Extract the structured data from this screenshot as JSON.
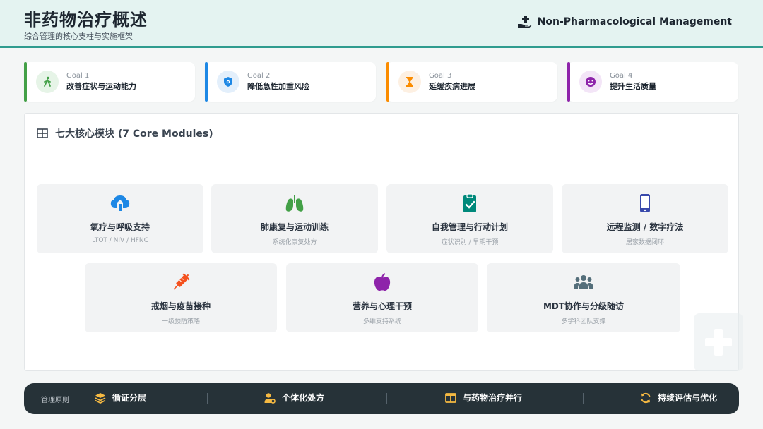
{
  "header": {
    "title": "非药物治疗概述",
    "subtitle": "综合管理的核心支柱与实施框架",
    "brand_label": "Non-Pharmacological Management",
    "brand_icon": "hand-holding-medical-icon"
  },
  "goals": [
    {
      "number": "Goal 1",
      "label": "改善症状与运动能力",
      "color": "#43a047",
      "icon": "walking-person-icon"
    },
    {
      "number": "Goal 2",
      "label": "降低急性加重风险",
      "color": "#1e88e5",
      "icon": "shield-virus-icon"
    },
    {
      "number": "Goal 3",
      "label": "延缓疾病进展",
      "color": "#fb8c00",
      "icon": "hourglass-icon"
    },
    {
      "number": "Goal 4",
      "label": "提升生活质量",
      "color": "#8e24aa",
      "icon": "smile-icon"
    }
  ],
  "modules_panel": {
    "title": "七大核心模块 (7 Core Modules)",
    "title_icon": "grid-icon",
    "modules": [
      {
        "title": "氧疗与呼吸支持",
        "subtitle": "LTOT / NIV / HFNC",
        "icon": "lungs-virus-icon",
        "color": "#1e88e5"
      },
      {
        "title": "肺康复与运动训练",
        "subtitle": "系统化康复处方",
        "icon": "lungs-icon",
        "color": "#43a047"
      },
      {
        "title": "自我管理与行动计划",
        "subtitle": "症状识别 / 早期干预",
        "icon": "clipboard-check-icon",
        "color": "#00897b"
      },
      {
        "title": "远程监测 / 数字疗法",
        "subtitle": "居家数据闭环",
        "icon": "mobile-phone-icon",
        "color": "#3949ab"
      },
      {
        "title": "戒烟与疫苗接种",
        "subtitle": "一级预防策略",
        "icon": "syringe-icon",
        "color": "#f4511e"
      },
      {
        "title": "营养与心理干预",
        "subtitle": "多维支持系统",
        "icon": "apple-icon",
        "color": "#8e24aa"
      },
      {
        "title": "MDT协作与分级随访",
        "subtitle": "多学科团队支撑",
        "icon": "users-icon",
        "color": "#546e7a"
      }
    ]
  },
  "footer": {
    "label": "管理原则",
    "items": [
      {
        "label": "循证分层",
        "icon": "layers-icon"
      },
      {
        "label": "个体化处方",
        "icon": "user-gear-icon"
      },
      {
        "label": "与药物治疗并行",
        "icon": "columns-icon"
      },
      {
        "label": "持续评估与优化",
        "icon": "sync-icon"
      }
    ],
    "accent": "#f5b942"
  }
}
